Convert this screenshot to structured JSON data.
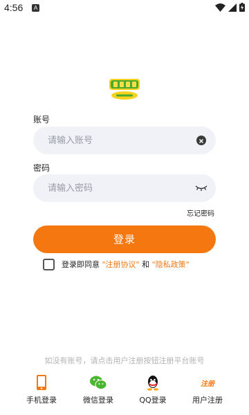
{
  "status_bar": {
    "time": "4:56",
    "badge": "A"
  },
  "app": {
    "logo_name": "app-logo",
    "accent_color": "#f57710"
  },
  "account": {
    "label": "账号",
    "placeholder": "请输入账号",
    "value": ""
  },
  "password": {
    "label": "密码",
    "placeholder": "请输入密码",
    "value": ""
  },
  "forgot_password": "忘记密码",
  "login_button": "登录",
  "agreement": {
    "prefix": "登录即同意",
    "terms": "\"注册协议\"",
    "and": "和",
    "privacy": "\"隐私政策\"",
    "checked": false
  },
  "hint": "如没有账号，请点击用户注册按钮注册平台账号",
  "bottom_nav": [
    {
      "label": "手机登录",
      "icon": "phone-icon"
    },
    {
      "label": "微信登录",
      "icon": "wechat-icon"
    },
    {
      "label": "QQ登录",
      "icon": "qq-icon"
    },
    {
      "label": "用户注册",
      "icon": "register-icon",
      "icon_text": "注册"
    }
  ]
}
